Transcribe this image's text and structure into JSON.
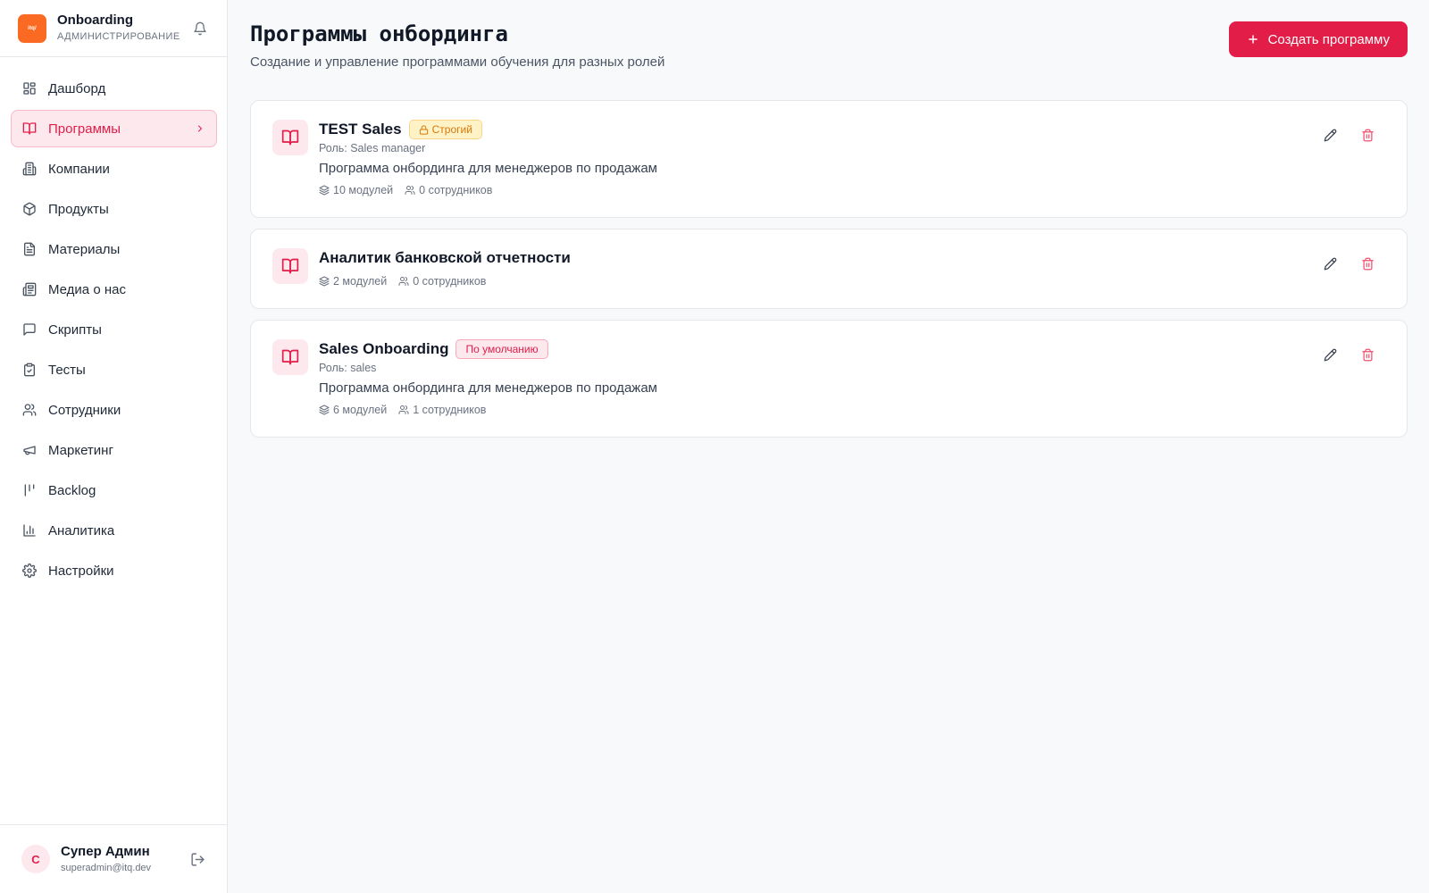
{
  "brand": {
    "title": "Onboarding",
    "subtitle": "АДМИНИСТРИРОВАНИЕ",
    "logo_text": "itq/"
  },
  "sidebar": {
    "items": [
      {
        "label": "Дашборд",
        "icon": "dashboard-icon"
      },
      {
        "label": "Программы",
        "icon": "book-icon",
        "active": true
      },
      {
        "label": "Компании",
        "icon": "building-icon"
      },
      {
        "label": "Продукты",
        "icon": "package-icon"
      },
      {
        "label": "Материалы",
        "icon": "file-text-icon"
      },
      {
        "label": "Медиа о нас",
        "icon": "newspaper-icon"
      },
      {
        "label": "Скрипты",
        "icon": "message-square-icon"
      },
      {
        "label": "Тесты",
        "icon": "clipboard-icon"
      },
      {
        "label": "Сотрудники",
        "icon": "users-icon"
      },
      {
        "label": "Маркетинг",
        "icon": "megaphone-icon"
      },
      {
        "label": "Backlog",
        "icon": "backlog-icon"
      },
      {
        "label": "Аналитика",
        "icon": "bar-chart-icon"
      },
      {
        "label": "Настройки",
        "icon": "settings-icon"
      }
    ]
  },
  "user": {
    "initial": "С",
    "name": "Супер Админ",
    "email": "superadmin@itq.dev"
  },
  "header": {
    "title": "Программы онбординга",
    "subtitle": "Создание и управление программами обучения для разных ролей",
    "create_label": "Создать программу"
  },
  "programs": [
    {
      "title": "TEST Sales",
      "badge": "Строгий",
      "role": "Роль: Sales manager",
      "description": "Программа онбординга для менеджеров по продажам",
      "modules": "10 модулей",
      "employees": "0 сотрудников"
    },
    {
      "title": "Аналитик банковской отчетности",
      "modules": "2 модулей",
      "employees": "0 сотрудников"
    },
    {
      "title": "Sales Onboarding",
      "badge": "По умолчанию",
      "role": "Роль: sales",
      "description": "Программа онбординга для менеджеров по продажам",
      "modules": "6 модулей",
      "employees": "1 сотрудников"
    }
  ],
  "colors": {
    "accent": "#e11d48",
    "accent_soft": "#fde8ee",
    "logo": "#fb6a22",
    "strict_badge": "#d97706"
  }
}
